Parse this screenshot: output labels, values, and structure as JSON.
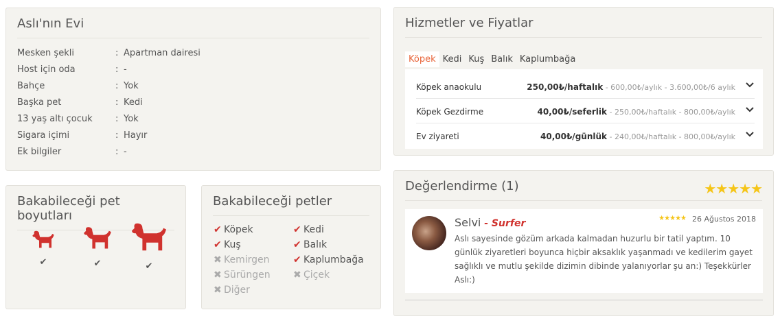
{
  "house": {
    "title": "Aslı'nın Evi",
    "rows": [
      {
        "key": "Mesken şekli",
        "value": "Apartman dairesi"
      },
      {
        "key": "Host için oda",
        "value": "-"
      },
      {
        "key": "Bahçe",
        "value": "Yok"
      },
      {
        "key": "Başka pet",
        "value": "Kedi"
      },
      {
        "key": "13 yaş altı çocuk",
        "value": "Yok"
      },
      {
        "key": "Sigara içimi",
        "value": "Hayır"
      },
      {
        "key": "Ek bilgiler",
        "value": "-"
      }
    ],
    "separator": ":"
  },
  "sizes": {
    "title": "Bakabileceği pet boyutları",
    "items": [
      {
        "icon": "small-dog-icon",
        "check": "✔"
      },
      {
        "icon": "medium-dog-icon",
        "check": "✔"
      },
      {
        "icon": "large-dog-icon",
        "check": "✔"
      }
    ],
    "dog_color": "#d0322e"
  },
  "pets": {
    "title": "Bakabileceği petler",
    "items": [
      {
        "label": "Köpek",
        "allowed": true,
        "mark": "✔"
      },
      {
        "label": "Kedi",
        "allowed": true,
        "mark": "✔"
      },
      {
        "label": "Kuş",
        "allowed": true,
        "mark": "✔"
      },
      {
        "label": "Balık",
        "allowed": true,
        "mark": "✔"
      },
      {
        "label": "Kemirgen",
        "allowed": false,
        "mark": "✖"
      },
      {
        "label": "Kaplumbağa",
        "allowed": true,
        "mark": "✔"
      },
      {
        "label": "Sürüngen",
        "allowed": false,
        "mark": "✖"
      },
      {
        "label": "Çiçek",
        "allowed": false,
        "mark": "✖"
      },
      {
        "label": "Diğer",
        "allowed": false,
        "mark": "✖"
      }
    ],
    "check_color": "#d0322e"
  },
  "services": {
    "title": "Hizmetler ve Fiyatlar",
    "tabs": [
      {
        "label": "Köpek",
        "active": true
      },
      {
        "label": "Kedi",
        "active": false
      },
      {
        "label": "Kuş",
        "active": false
      },
      {
        "label": "Balık",
        "active": false
      },
      {
        "label": "Kaplumbağa",
        "active": false
      }
    ],
    "rows": [
      {
        "name": "Köpek anaokulu",
        "price": "250,00₺/haftalık",
        "rest": " - 600,00₺/aylık - 3.600,00₺/6 aylık"
      },
      {
        "name": "Köpek Gezdirme",
        "price": "40,00₺/seferlik",
        "rest": " - 250,00₺/haftalık - 800,00₺/aylık"
      },
      {
        "name": "Ev ziyareti",
        "price": "40,00₺/günlük",
        "rest": " - 240,00₺/haftalık - 800,00₺/aylık"
      }
    ],
    "active_tab_color": "#e8653a"
  },
  "reviews": {
    "title": "Değerlendirme (1)",
    "overall_stars": "★★★★★",
    "overall_rating": 5,
    "items": [
      {
        "name": "Selvi",
        "dash": " - ",
        "badge": "Surfer",
        "stars": "★★★★★",
        "rating": 5,
        "date": "26 Ağustos 2018",
        "text": "Aslı sayesinde gözüm arkada kalmadan huzurlu bir tatil yaptım. 10 günlük ziyaretleri boyunca hiçbir aksaklık yaşanmadı ve kedilerim gayet sağlıklı ve mutlu şekilde dizimin dibinde yalanıyorlar şu an:) Teşekkürler Aslı:)"
      }
    ],
    "star_color": "#f5c518"
  }
}
